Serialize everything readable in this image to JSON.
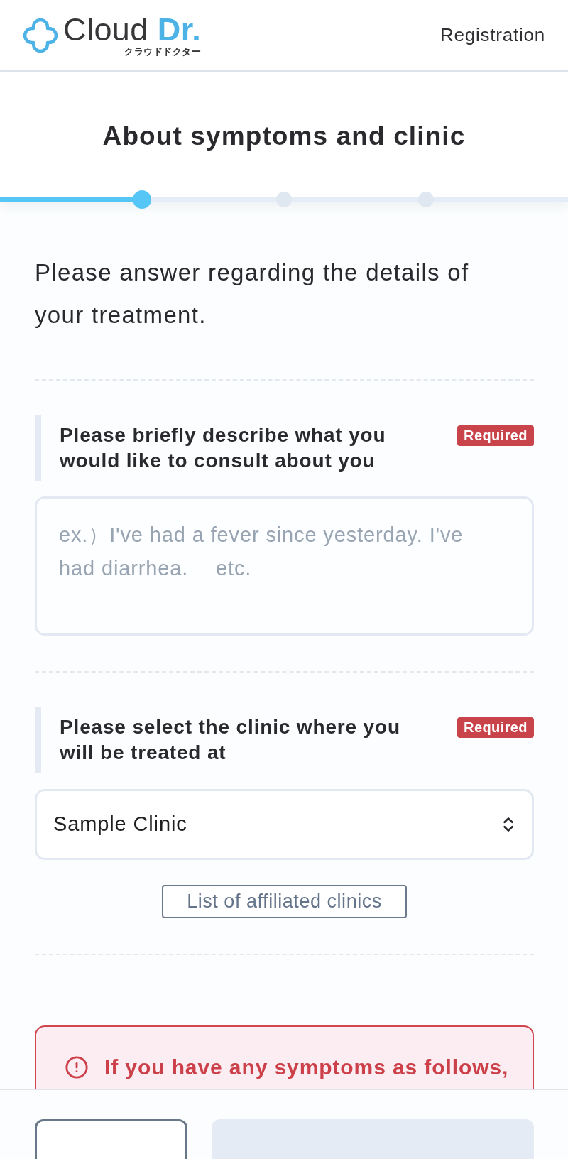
{
  "header": {
    "logo": {
      "wordmark": "Cloud",
      "wordmark_accent": "Dr.",
      "subtitle": "クラウドドクター"
    },
    "link": "Registration"
  },
  "page_title": "About symptoms and clinic",
  "progress": {
    "steps": [
      {
        "selected": true
      },
      {
        "selected": false
      },
      {
        "selected": false
      }
    ]
  },
  "intro": "Please answer regarding the details of your treatment.",
  "questions": [
    {
      "kind": "textarea",
      "label": "Please briefly describe what you would like to consult about you",
      "badge": "Required",
      "placeholder": "ex.）I've had a fever since yesterday. I've had diarrhea.　 etc."
    },
    {
      "kind": "select",
      "label": "Please select the clinic where you will be treated at",
      "badge": "Required",
      "value": "Sample Clinic",
      "link_button": "List of affiliated clinics"
    }
  ],
  "alert": {
    "text": "If you have any symptoms as follows,"
  },
  "footer": {
    "buttons": [
      {
        "kind": "outline"
      },
      {
        "kind": "filled"
      }
    ]
  }
}
